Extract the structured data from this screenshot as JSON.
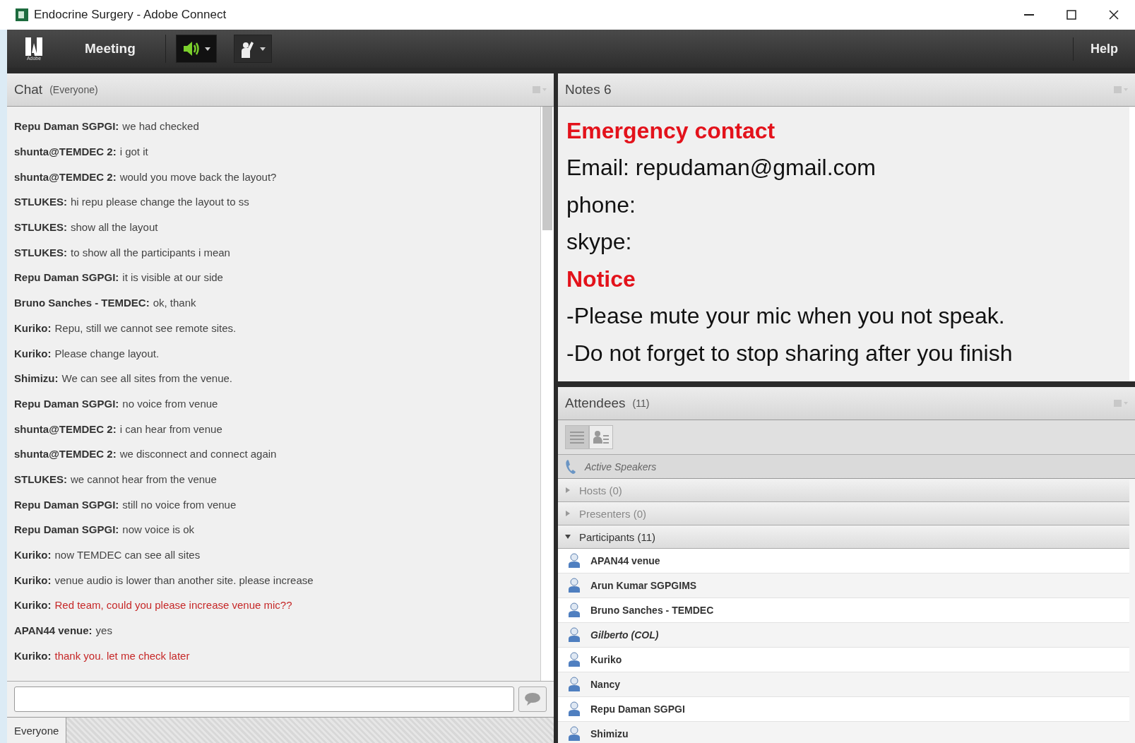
{
  "window": {
    "title": "Endocrine Surgery - Adobe Connect"
  },
  "toolbar": {
    "logo_caption": "Adobe",
    "menu": "Meeting",
    "speaker_on": true,
    "help": "Help"
  },
  "chat": {
    "title": "Chat",
    "scope": "(Everyone)",
    "messages": [
      {
        "sender": "Repu Daman SGPGI:",
        "text": "we had checked",
        "highlighted": false
      },
      {
        "sender": "shunta@TEMDEC 2:",
        "text": "i got it",
        "highlighted": false
      },
      {
        "sender": "shunta@TEMDEC 2:",
        "text": "would you move back the layout?",
        "highlighted": false
      },
      {
        "sender": "STLUKES:",
        "text": "hi repu please change the layout to ss",
        "highlighted": false
      },
      {
        "sender": "STLUKES:",
        "text": "show all the layout",
        "highlighted": false
      },
      {
        "sender": "STLUKES:",
        "text": "to show all the participants i mean",
        "highlighted": false
      },
      {
        "sender": "Repu Daman SGPGI:",
        "text": "it is visible at our side",
        "highlighted": false
      },
      {
        "sender": "Bruno Sanches - TEMDEC:",
        "text": "ok, thank",
        "highlighted": false
      },
      {
        "sender": "Kuriko:",
        "text": "Repu, still we cannot see remote sites.",
        "highlighted": false
      },
      {
        "sender": "Kuriko:",
        "text": "Please change layout.",
        "highlighted": false
      },
      {
        "sender": "Shimizu:",
        "text": "We can see all sites from the venue.",
        "highlighted": false
      },
      {
        "sender": "Repu Daman SGPGI:",
        "text": "no voice from venue",
        "highlighted": false
      },
      {
        "sender": "shunta@TEMDEC 2:",
        "text": "i can hear from venue",
        "highlighted": false
      },
      {
        "sender": "shunta@TEMDEC 2:",
        "text": "we disconnect and connect again",
        "highlighted": false
      },
      {
        "sender": "STLUKES:",
        "text": "we cannot hear from the venue",
        "highlighted": false
      },
      {
        "sender": "Repu Daman SGPGI:",
        "text": "still no voice from venue",
        "highlighted": false
      },
      {
        "sender": "Repu Daman SGPGI:",
        "text": "now voice is ok",
        "highlighted": false
      },
      {
        "sender": "Kuriko:",
        "text": "now TEMDEC can see all sites",
        "highlighted": false
      },
      {
        "sender": "Kuriko:",
        "text": "venue audio is lower than another site. please increase",
        "highlighted": false
      },
      {
        "sender": "Kuriko:",
        "text": "Red team, could you please increase venue mic??",
        "highlighted": true
      },
      {
        "sender": "APAN44 venue:",
        "text": "yes",
        "highlighted": false
      },
      {
        "sender": "Kuriko:",
        "text": "thank you. let me check later",
        "highlighted": true
      }
    ],
    "recipient_tab": "Everyone"
  },
  "notes": {
    "title": "Notes 6",
    "lines": [
      {
        "kind": "heading",
        "text": "Emergency contact"
      },
      {
        "kind": "text",
        "text": "Email: repudaman@gmail.com"
      },
      {
        "kind": "text",
        "text": "phone:"
      },
      {
        "kind": "text",
        "text": "skype:"
      },
      {
        "kind": "heading",
        "text": "Notice"
      },
      {
        "kind": "text",
        "text": "-Please mute your mic when you not speak."
      },
      {
        "kind": "text",
        "text": "-Do not forget to stop sharing after you finish"
      }
    ]
  },
  "attendees": {
    "title": "Attendees",
    "count": "(11)",
    "views": [
      {
        "kind": "list",
        "selected": true
      },
      {
        "kind": "cards",
        "selected": false
      }
    ],
    "active_speakers": "Active Speakers",
    "groups": [
      {
        "label": "Hosts (0)",
        "expanded": false,
        "disabled": true
      },
      {
        "label": "Presenters (0)",
        "expanded": false,
        "disabled": true
      },
      {
        "label": "Participants (11)",
        "expanded": true,
        "disabled": false
      }
    ],
    "participants": [
      {
        "name": "APAN44 venue",
        "guest": false
      },
      {
        "name": "Arun Kumar SGPGIMS",
        "guest": false
      },
      {
        "name": "Bruno Sanches - TEMDEC",
        "guest": false
      },
      {
        "name": "Gilberto (COL)",
        "guest": true
      },
      {
        "name": "Kuriko",
        "guest": false
      },
      {
        "name": "Nancy",
        "guest": false
      },
      {
        "name": "Repu Daman SGPGI",
        "guest": false
      },
      {
        "name": "Shimizu",
        "guest": false
      }
    ]
  }
}
